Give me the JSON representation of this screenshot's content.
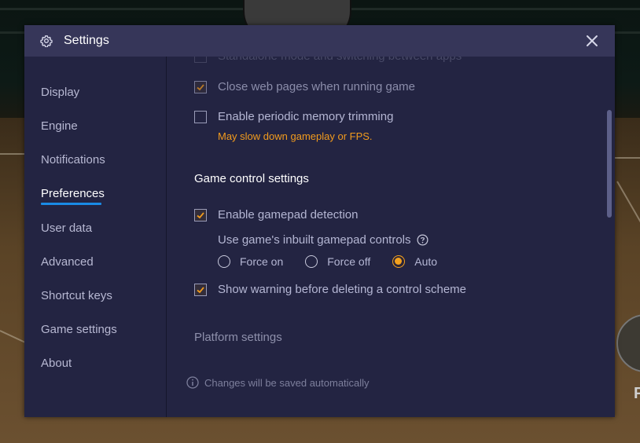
{
  "window": {
    "title": "Settings",
    "close_icon": "close-icon",
    "settings_icon": "gear-icon"
  },
  "sidebar": {
    "items": [
      {
        "label": "Display",
        "active": false
      },
      {
        "label": "Engine",
        "active": false
      },
      {
        "label": "Notifications",
        "active": false
      },
      {
        "label": "Preferences",
        "active": true
      },
      {
        "label": "User data",
        "active": false
      },
      {
        "label": "Advanced",
        "active": false
      },
      {
        "label": "Shortcut keys",
        "active": false
      },
      {
        "label": "Game settings",
        "active": false
      },
      {
        "label": "About",
        "active": false
      }
    ]
  },
  "content": {
    "options": [
      {
        "label": "Standalone mode and switching between apps",
        "checked": false,
        "clipped": true
      },
      {
        "label": "Close web pages when running game",
        "checked": true,
        "disabled": true
      },
      {
        "label": "Enable periodic memory trimming",
        "checked": false,
        "warning": "May slow down gameplay or FPS."
      }
    ],
    "game_control": {
      "heading": "Game control settings",
      "gamepad_detection": {
        "label": "Enable gamepad detection",
        "checked": true
      },
      "inbuilt_controls": {
        "label": "Use game's inbuilt gamepad controls",
        "help_icon": "help-circle-icon",
        "options": [
          "Force on",
          "Force off",
          "Auto"
        ],
        "selected": "Auto"
      },
      "delete_warning": {
        "label": "Show warning before deleting a control scheme",
        "checked": true
      }
    },
    "platform": {
      "heading": "Platform settings"
    },
    "footer_note": "Changes will be saved automatically",
    "info_icon": "info-icon"
  },
  "colors": {
    "accent_underline": "#1a8be6",
    "checkmark": "#f29b1d",
    "warning_text": "#f29b1d",
    "radio_selected": "#f3a11e",
    "titlebar": "#363659",
    "panel": "#232442"
  }
}
